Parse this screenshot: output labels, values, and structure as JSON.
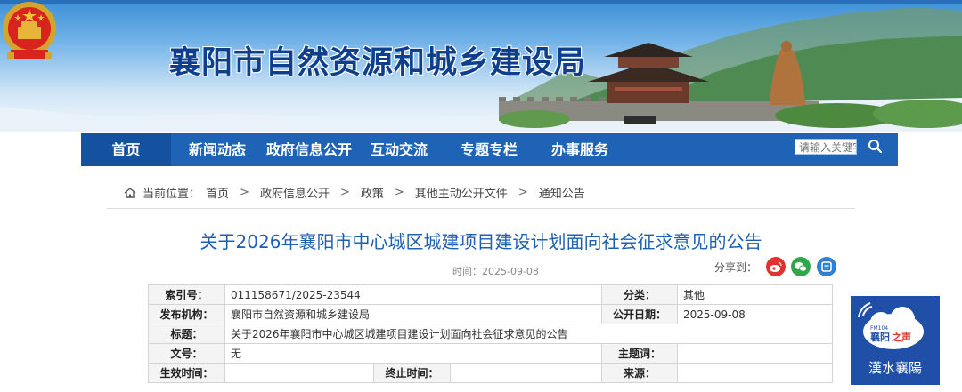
{
  "header": {
    "site_title": "襄阳市自然资源和城乡建设局",
    "colors": {
      "nav_bg": "#1e63b5",
      "nav_active": "#1452a0",
      "title": "#0e3f8c"
    }
  },
  "nav": {
    "items": [
      {
        "label": "首页"
      },
      {
        "label": "新闻动态"
      },
      {
        "label": "政府信息公开"
      },
      {
        "label": "互动交流"
      },
      {
        "label": "专题专栏"
      },
      {
        "label": "办事服务"
      }
    ],
    "search_placeholder": "请输入关键字",
    "search_icon": "search-icon"
  },
  "breadcrumb": {
    "prefix": "当前位置：",
    "items": [
      "首页",
      "政府信息公开",
      "政策",
      "其他主动公开文件",
      "通知公告"
    ],
    "separator": ">"
  },
  "article": {
    "title": "关于2026年襄阳市中心城区城建项目建设计划面向社会征求意见的公告",
    "time": "时间：2025-09-08",
    "share_label": "分享到：",
    "share_icons": [
      "weibo-icon",
      "wechat-icon",
      "qzone-icon"
    ]
  },
  "meta": {
    "index_label": "索引号：",
    "index_value": "011158671/2025-23544",
    "category_label": "分类：",
    "category_value": "其他",
    "publisher_label": "发布机构：",
    "publisher_value": "襄阳市自然资源和城乡建设局",
    "pubdate_label": "公开日期：",
    "pubdate_value": "2025-09-08",
    "title_label": "标题：",
    "title_value": "关于2026年襄阳市中心城区城建项目建设计划面向社会征求意见的公告",
    "docno_label": "文号：",
    "docno_value": "无",
    "topic_label": "主题词：",
    "topic_value": "",
    "effective_label": "生效时间：",
    "effective_value": "",
    "end_label": "终止时间：",
    "end_value": "",
    "source_label": "来源：",
    "source_value": ""
  },
  "side_widget": {
    "fm": "FM104",
    "brand_a": "襄阳",
    "brand_b": "之声",
    "motto": "漢水襄陽"
  }
}
